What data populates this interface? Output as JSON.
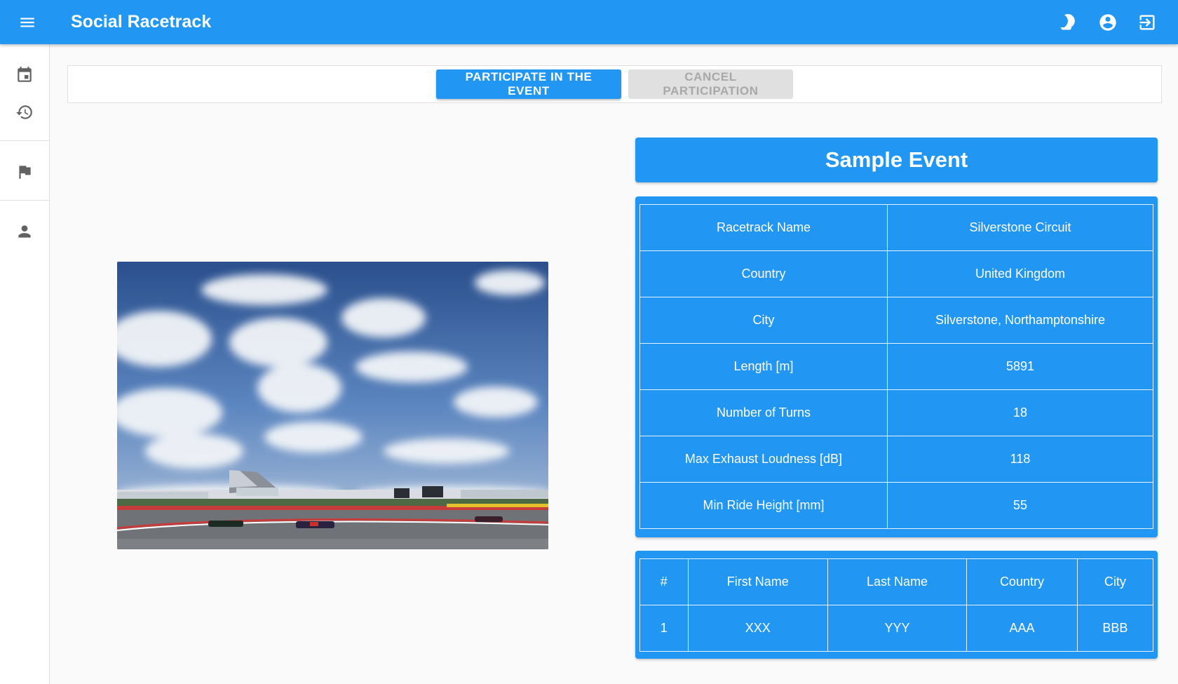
{
  "app": {
    "title": "Social Racetrack",
    "menu_icon": "menu-icon"
  },
  "header_actions": [
    {
      "name": "theme-toggle-icon"
    },
    {
      "name": "account-circle-icon"
    },
    {
      "name": "logout-icon"
    }
  ],
  "sidebar": {
    "items": [
      {
        "name": "calendar-icon"
      },
      {
        "name": "history-icon"
      },
      {
        "name": "flag-icon"
      },
      {
        "name": "person-icon"
      }
    ]
  },
  "actions": {
    "participate_label": "PARTICIPATE IN THE EVENT",
    "cancel_label": "CANCEL PARTICIPATION"
  },
  "event": {
    "title": "Sample Event",
    "details": [
      {
        "key": "Racetrack Name",
        "value": "Silverstone Circuit"
      },
      {
        "key": "Country",
        "value": "United Kingdom"
      },
      {
        "key": "City",
        "value": "Silverstone, Northamptonshire"
      },
      {
        "key": "Length [m]",
        "value": "5891"
      },
      {
        "key": "Number of Turns",
        "value": "18"
      },
      {
        "key": "Max Exhaust Loudness [dB]",
        "value": "118"
      },
      {
        "key": "Min Ride Height [mm]",
        "value": "55"
      }
    ]
  },
  "participants": {
    "headers": [
      "#",
      "First Name",
      "Last Name",
      "Country",
      "City"
    ],
    "rows": [
      [
        "1",
        "XXX",
        "YYY",
        "AAA",
        "BBB"
      ]
    ]
  },
  "colors": {
    "primary": "#2196f3",
    "background": "#fafafa",
    "disabled": "#e0e0e0"
  }
}
